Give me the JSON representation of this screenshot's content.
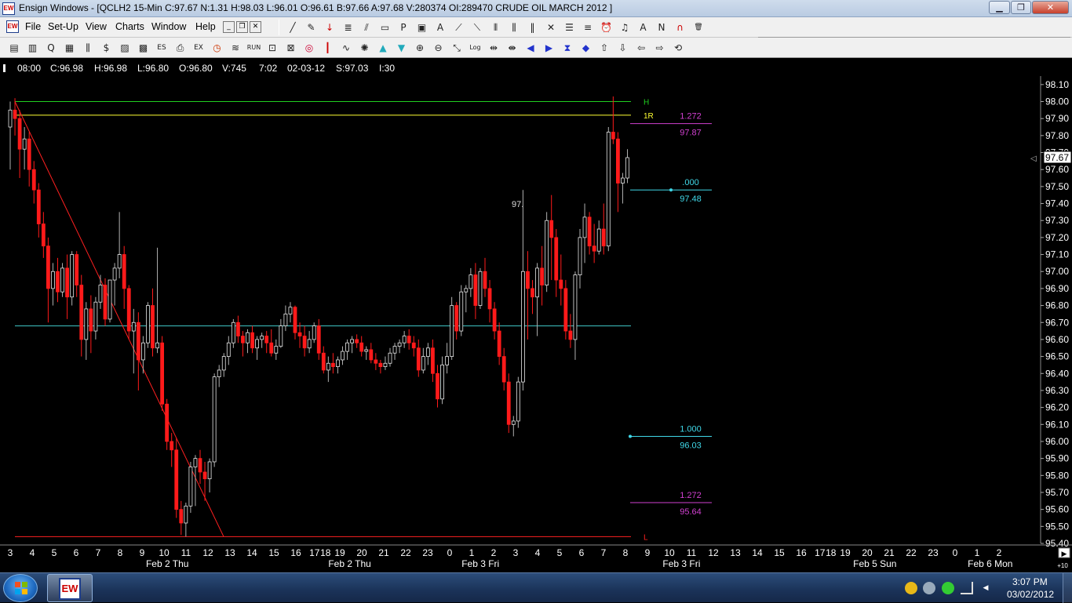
{
  "window": {
    "app_icon_text": "EW",
    "title": "Ensign Windows - [QCLH2 15-Min C:97.67 N:1.31 H:98.03 L:96.01 O:96.61 B:97.66 A:97.68 V:280374 OI:289470 CRUDE OIL MARCH 2012 ]",
    "minimize_glyph": "▁",
    "restore_glyph": "❐",
    "close_glyph": "✕"
  },
  "menu": {
    "icon_text": "EW",
    "items": [
      "File",
      "Set-Up",
      "View",
      "Charts",
      "Window",
      "Help"
    ],
    "mdi_minimize": "_",
    "mdi_restore": "❐",
    "mdi_close": "✕",
    "toolbar1_icons": [
      "line-draw-icon",
      "pencil-icon",
      "arrow-down-icon",
      "fibonacci-icon",
      "channel-icon",
      "rectangle-icon",
      "p-icon",
      "box-icon",
      "text-a-icon",
      "gann-fan-icon",
      "fib-fan-icon",
      "vertical-lines-icon",
      "cycles-icon",
      "cycle-fib-icon",
      "cross-lines-icon",
      "horizontal-lines-icon",
      "equal-lines-icon",
      "alarm-clock-icon",
      "bell-icon",
      "arrow-a-icon",
      "n-wave-icon",
      "magnet-icon",
      "trash-icon"
    ]
  },
  "toolbar": {
    "icons": [
      "tile-windows-icon",
      "quote-page-icon",
      "q-icon",
      "news-icon",
      "bar-chart-icon",
      "dollar-icon",
      "portfolio-icon",
      "options-icon",
      "espl-icon",
      "print-icon",
      "exit-icon",
      "clock-icon",
      "waves-icon",
      "run-icon",
      "lock-icon",
      "lock-closed-icon",
      "globe-icon",
      "candle-icon",
      "line-study-icon",
      "color-wheel-icon",
      "triangle-up-icon",
      "triangle-down-icon",
      "zoom-in-icon",
      "zoom-out-icon",
      "scale-icon",
      "log-icon",
      "expand-h-icon",
      "compress-h-icon",
      "scroll-left-icon",
      "scroll-right-icon",
      "expand-v-icon",
      "compress-v-icon",
      "arrow-up-icon",
      "arrow-down2-icon",
      "arrow-left-icon",
      "arrow-right-icon",
      "reset-icon"
    ],
    "run_label": "RUN",
    "espl_label": "ESPL",
    "exit_label": "EXIT",
    "log_label": "Log",
    "reset_label": "RESET",
    "cmd_value": ""
  },
  "infobar": {
    "time": "08:00",
    "close": "C:96.98",
    "high": "H:96.98",
    "low": "L:96.80",
    "open": "O:96.80",
    "volume": "V:745",
    "clock": "7:02",
    "date": "02-03-12",
    "settle": "S:97.03",
    "interval": "I:30"
  },
  "colors": {
    "up": "#e8e8e8",
    "down": "#ff1a1a",
    "wick": "#b0b0b0",
    "line_high": "#20d020",
    "line_res": "#ffff33",
    "line_mid": "#40c8c8",
    "line_low": "#ff2020",
    "fib_magenta": "#d040d0",
    "fib_cyan": "#40d8e8"
  },
  "chart_data": {
    "type": "candlestick",
    "symbol": "QCLH2",
    "timeframe": "15-Min",
    "ylim": [
      95.4,
      98.15
    ],
    "y_ticks": [
      "98.10",
      "98.00",
      "97.90",
      "97.80",
      "97.70",
      "97.60",
      "97.50",
      "97.40",
      "97.30",
      "97.20",
      "97.10",
      "97.00",
      "96.90",
      "96.80",
      "96.70",
      "96.60",
      "96.50",
      "96.40",
      "96.30",
      "96.20",
      "96.10",
      "96.00",
      "95.90",
      "95.80",
      "95.70",
      "95.60",
      "95.50",
      "95.40"
    ],
    "last_price": "97.67",
    "x_ticks": [
      {
        "label": "3",
        "i": 0
      },
      {
        "label": "4",
        "i": 2
      },
      {
        "label": "5",
        "i": 4
      },
      {
        "label": "6",
        "i": 6
      },
      {
        "label": "7",
        "i": 8
      },
      {
        "label": "8",
        "i": 10
      },
      {
        "label": "9",
        "i": 12
      },
      {
        "label": "10",
        "i": 14
      },
      {
        "label": "11",
        "i": 16
      },
      {
        "label": "12",
        "i": 18
      },
      {
        "label": "13",
        "i": 20
      },
      {
        "label": "14",
        "i": 22
      },
      {
        "label": "15",
        "i": 24
      },
      {
        "label": "16",
        "i": 26
      },
      {
        "label": "17",
        "i": 27.7
      },
      {
        "label": "18",
        "i": 28.7
      },
      {
        "label": "19",
        "i": 30
      },
      {
        "label": "20",
        "i": 32
      },
      {
        "label": "21",
        "i": 34
      },
      {
        "label": "22",
        "i": 36
      },
      {
        "label": "23",
        "i": 38
      },
      {
        "label": "0",
        "i": 40
      },
      {
        "label": "1",
        "i": 42
      },
      {
        "label": "2",
        "i": 44
      },
      {
        "label": "3",
        "i": 46
      },
      {
        "label": "4",
        "i": 48
      },
      {
        "label": "5",
        "i": 50
      },
      {
        "label": "6",
        "i": 52
      },
      {
        "label": "7",
        "i": 54
      },
      {
        "label": "8",
        "i": 56
      },
      {
        "label": "9",
        "i": 58
      },
      {
        "label": "10",
        "i": 60
      },
      {
        "label": "11",
        "i": 62
      },
      {
        "label": "12",
        "i": 64
      },
      {
        "label": "13",
        "i": 66
      },
      {
        "label": "14",
        "i": 68
      },
      {
        "label": "15",
        "i": 70
      },
      {
        "label": "16",
        "i": 72
      },
      {
        "label": "17",
        "i": 73.7
      },
      {
        "label": "18",
        "i": 74.7
      },
      {
        "label": "19",
        "i": 76
      },
      {
        "label": "20",
        "i": 78
      },
      {
        "label": "21",
        "i": 80
      },
      {
        "label": "22",
        "i": 82
      },
      {
        "label": "23",
        "i": 84
      },
      {
        "label": "0",
        "i": 86
      },
      {
        "label": "1",
        "i": 88
      },
      {
        "label": "2",
        "i": 90
      }
    ],
    "date_labels": [
      {
        "label": "Feb 2 Thu",
        "i": 14.3
      },
      {
        "label": "Feb 2 Thu",
        "i": 30.9
      },
      {
        "label": "Feb 3 Fri",
        "i": 42.8
      },
      {
        "label": "Feb 3 Fri",
        "i": 61.1
      },
      {
        "label": "Feb 5 Sun",
        "i": 78.7
      },
      {
        "label": "Feb 6 Mon",
        "i": 89.2
      }
    ],
    "horizontal_lines": [
      {
        "name": "H",
        "price": 98.0,
        "color": "#20d020"
      },
      {
        "name": "1R",
        "price": 97.92,
        "color": "#ffff33"
      },
      {
        "name": "",
        "price": 96.68,
        "color": "#40c8c8"
      },
      {
        "name": "L",
        "price": 95.44,
        "color": "#ff2020"
      }
    ],
    "trend_line": {
      "from": {
        "i": 0,
        "price": 98.0
      },
      "to": {
        "i": 19.5,
        "price": 95.44
      }
    },
    "fib_levels": [
      {
        "ratio": "1.272",
        "price": 97.87,
        "price_label": "97.87",
        "color": "#d040d0"
      },
      {
        "ratio": ".000",
        "price": 97.48,
        "price_label": "97.48",
        "color": "#40d8e8"
      },
      {
        "ratio": "1.000",
        "price": 96.03,
        "price_label": "96.03",
        "color": "#40d8e8"
      },
      {
        "ratio": "1.272",
        "price": 95.64,
        "price_label": "95.64",
        "color": "#d040d0"
      }
    ],
    "annotation": {
      "text": "97.",
      "i": 46.7,
      "price": 97.38
    },
    "candles": [
      [
        97.85,
        98.0,
        97.6,
        97.95
      ],
      [
        97.95,
        98.02,
        97.8,
        97.9
      ],
      [
        97.9,
        97.95,
        97.55,
        97.72
      ],
      [
        97.72,
        97.85,
        97.6,
        97.78
      ],
      [
        97.78,
        97.82,
        97.5,
        97.6
      ],
      [
        97.6,
        97.65,
        97.4,
        97.48
      ],
      [
        97.48,
        97.52,
        97.2,
        97.28
      ],
      [
        97.28,
        97.35,
        97.08,
        97.15
      ],
      [
        97.15,
        97.2,
        96.7,
        96.9
      ],
      [
        96.9,
        97.05,
        96.8,
        97.0
      ],
      [
        97.0,
        97.08,
        96.82,
        96.88
      ],
      [
        96.88,
        97.05,
        96.85,
        97.02
      ],
      [
        97.02,
        97.1,
        96.72,
        96.85
      ],
      [
        96.85,
        97.12,
        96.8,
        97.1
      ],
      [
        97.1,
        97.12,
        96.85,
        96.92
      ],
      [
        96.92,
        96.98,
        96.5,
        96.6
      ],
      [
        96.6,
        96.82,
        96.48,
        96.78
      ],
      [
        96.78,
        96.86,
        96.52,
        96.65
      ],
      [
        96.65,
        96.85,
        96.6,
        96.82
      ],
      [
        96.82,
        96.98,
        96.78,
        96.92
      ],
      [
        96.92,
        96.96,
        96.68,
        96.72
      ],
      [
        96.72,
        96.95,
        96.7,
        96.95
      ],
      [
        96.95,
        97.05,
        96.8,
        97.02
      ],
      [
        97.02,
        97.35,
        96.96,
        97.1
      ],
      [
        97.1,
        97.15,
        96.78,
        96.9
      ],
      [
        96.9,
        96.92,
        96.6,
        96.65
      ],
      [
        96.65,
        96.78,
        96.4,
        96.7
      ],
      [
        96.7,
        96.76,
        96.3,
        96.48
      ],
      [
        96.48,
        96.62,
        96.4,
        96.58
      ],
      [
        96.58,
        96.82,
        96.55,
        96.8
      ],
      [
        96.8,
        96.9,
        96.5,
        96.55
      ],
      [
        96.55,
        97.14,
        96.52,
        96.58
      ],
      [
        96.58,
        96.62,
        96.18,
        96.22
      ],
      [
        96.22,
        96.25,
        95.95,
        96.0
      ],
      [
        96.0,
        96.05,
        95.85,
        95.95
      ],
      [
        95.95,
        96.02,
        95.55,
        95.6
      ],
      [
        95.6,
        95.65,
        95.45,
        95.52
      ],
      [
        95.52,
        95.64,
        95.44,
        95.62
      ],
      [
        95.62,
        95.88,
        95.58,
        95.85
      ],
      [
        95.85,
        95.92,
        95.62,
        95.9
      ],
      [
        95.9,
        95.95,
        95.75,
        95.82
      ],
      [
        95.82,
        95.88,
        95.65,
        95.78
      ],
      [
        95.78,
        95.9,
        95.7,
        95.88
      ],
      [
        95.88,
        96.4,
        95.85,
        96.38
      ],
      [
        96.38,
        96.45,
        96.32,
        96.42
      ],
      [
        96.42,
        96.52,
        96.38,
        96.5
      ],
      [
        96.5,
        96.62,
        96.45,
        96.58
      ],
      [
        96.58,
        96.72,
        96.55,
        96.7
      ],
      [
        96.7,
        96.74,
        96.58,
        96.62
      ],
      [
        96.62,
        96.65,
        96.5,
        96.58
      ],
      [
        96.58,
        96.66,
        96.52,
        96.64
      ],
      [
        96.64,
        96.68,
        96.52,
        96.55
      ],
      [
        96.55,
        96.62,
        96.48,
        96.6
      ],
      [
        96.6,
        96.64,
        96.55,
        96.62
      ],
      [
        96.62,
        96.65,
        96.52,
        96.58
      ],
      [
        96.58,
        96.66,
        96.5,
        96.52
      ],
      [
        96.52,
        96.6,
        96.48,
        96.56
      ],
      [
        96.56,
        96.72,
        96.55,
        96.68
      ],
      [
        96.68,
        96.8,
        96.65,
        96.75
      ],
      [
        96.75,
        96.82,
        96.7,
        96.79
      ],
      [
        96.79,
        96.8,
        96.6,
        96.64
      ],
      [
        96.64,
        96.7,
        96.55,
        96.62
      ],
      [
        96.62,
        96.68,
        96.5,
        96.55
      ],
      [
        96.55,
        96.65,
        96.52,
        96.6
      ],
      [
        96.6,
        96.7,
        96.58,
        96.68
      ],
      [
        96.68,
        96.72,
        96.48,
        96.52
      ],
      [
        96.52,
        96.56,
        96.4,
        96.42
      ],
      [
        96.42,
        96.5,
        96.35,
        96.46
      ],
      [
        96.46,
        96.52,
        96.4,
        96.44
      ],
      [
        96.44,
        96.5,
        96.4,
        96.48
      ],
      [
        96.48,
        96.56,
        96.45,
        96.53
      ],
      [
        96.53,
        96.6,
        96.48,
        96.58
      ],
      [
        96.58,
        96.62,
        96.52,
        96.6
      ],
      [
        96.6,
        96.63,
        96.55,
        96.58
      ],
      [
        96.58,
        96.62,
        96.5,
        96.53
      ],
      [
        96.53,
        96.56,
        96.48,
        96.54
      ],
      [
        96.54,
        96.58,
        96.46,
        96.48
      ],
      [
        96.48,
        96.52,
        96.42,
        96.46
      ],
      [
        96.46,
        96.48,
        96.4,
        96.44
      ],
      [
        96.44,
        96.5,
        96.42,
        96.46
      ],
      [
        96.46,
        96.55,
        96.44,
        96.52
      ],
      [
        96.52,
        96.58,
        96.48,
        96.56
      ],
      [
        96.56,
        96.6,
        96.52,
        96.58
      ],
      [
        96.58,
        96.65,
        96.55,
        96.62
      ],
      [
        96.62,
        96.66,
        96.54,
        96.58
      ],
      [
        96.58,
        96.62,
        96.5,
        96.55
      ],
      [
        96.55,
        96.6,
        96.38,
        96.42
      ],
      [
        96.42,
        96.55,
        96.4,
        96.5
      ],
      [
        96.5,
        96.58,
        96.45,
        96.55
      ],
      [
        96.55,
        96.6,
        96.35,
        96.4
      ],
      [
        96.4,
        96.45,
        96.2,
        96.25
      ],
      [
        96.25,
        96.5,
        96.22,
        96.45
      ],
      [
        96.45,
        96.58,
        96.4,
        96.5
      ],
      [
        96.5,
        96.85,
        96.48,
        96.8
      ],
      [
        96.8,
        96.82,
        96.6,
        96.65
      ],
      [
        96.65,
        96.92,
        96.62,
        96.88
      ],
      [
        96.88,
        96.92,
        96.76,
        96.9
      ],
      [
        96.9,
        97.02,
        96.85,
        96.98
      ],
      [
        96.98,
        97.05,
        96.72,
        96.8
      ],
      [
        96.8,
        97.02,
        96.78,
        97.0
      ],
      [
        97.0,
        97.08,
        96.85,
        96.9
      ],
      [
        96.9,
        96.95,
        96.7,
        96.78
      ],
      [
        96.78,
        96.82,
        96.6,
        96.65
      ],
      [
        96.65,
        96.7,
        96.45,
        96.5
      ],
      [
        96.5,
        96.55,
        96.3,
        96.35
      ],
      [
        96.35,
        96.4,
        96.05,
        96.1
      ],
      [
        96.1,
        96.15,
        96.03,
        96.12
      ],
      [
        96.12,
        96.38,
        96.08,
        96.35
      ],
      [
        96.35,
        97.48,
        96.3,
        97.0
      ],
      [
        97.0,
        97.12,
        96.6,
        96.9
      ],
      [
        96.9,
        96.95,
        96.75,
        96.85
      ],
      [
        96.85,
        97.05,
        96.62,
        97.02
      ],
      [
        97.02,
        97.15,
        96.8,
        96.92
      ],
      [
        96.92,
        97.35,
        96.88,
        97.3
      ],
      [
        97.3,
        97.45,
        96.95,
        97.2
      ],
      [
        97.2,
        97.25,
        96.85,
        96.95
      ],
      [
        96.95,
        97.1,
        96.8,
        96.9
      ],
      [
        96.9,
        96.95,
        96.6,
        96.65
      ],
      [
        96.65,
        96.75,
        96.55,
        96.6
      ],
      [
        96.6,
        97.0,
        96.48,
        96.98
      ],
      [
        96.98,
        97.25,
        96.9,
        97.2
      ],
      [
        97.2,
        97.4,
        97.05,
        97.32
      ],
      [
        97.32,
        97.35,
        97.1,
        97.15
      ],
      [
        97.15,
        97.28,
        97.05,
        97.12
      ],
      [
        97.12,
        97.3,
        97.1,
        97.25
      ],
      [
        97.25,
        97.4,
        97.1,
        97.15
      ],
      [
        97.15,
        97.85,
        97.12,
        97.82
      ],
      [
        97.82,
        98.03,
        97.75,
        97.78
      ],
      [
        97.78,
        97.82,
        97.35,
        97.52
      ],
      [
        97.52,
        97.58,
        97.4,
        97.55
      ],
      [
        97.55,
        97.72,
        97.52,
        97.67
      ]
    ]
  },
  "taskbar": {
    "app_icon_text": "EW",
    "tray_icons": [
      "clock-tray-icon",
      "network-tray-icon",
      "green-tray-icon",
      "signal-tray-icon",
      "volume-tray-icon"
    ],
    "time": "3:07 PM",
    "date": "03/02/2012"
  }
}
